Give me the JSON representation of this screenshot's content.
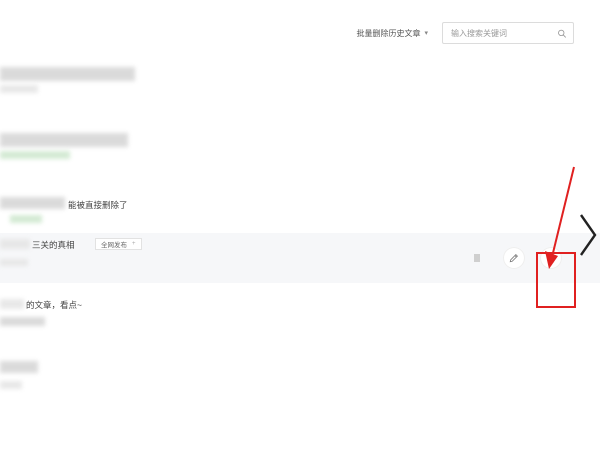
{
  "toolbar": {
    "batch_delete_label": "批量删除历史文章",
    "search_placeholder": "输入搜索关键词"
  },
  "articles": [
    {
      "title": "",
      "meta": ""
    },
    {
      "title": "",
      "meta": ""
    },
    {
      "title": "能被直接删除了",
      "meta": ""
    },
    {
      "title": "三关的真相",
      "tag_label": "全网发布",
      "meta": ""
    },
    {
      "title": "的文章，看点~",
      "meta": ""
    },
    {
      "title": "",
      "meta": ""
    }
  ],
  "colors": {
    "accent_red": "#e02020",
    "row_highlight": "#f6f7f9",
    "border": "#dcdcdc"
  },
  "icons": [
    "search-icon",
    "edit-icon",
    "trash-icon",
    "chevron-right-icon",
    "caret-down-icon"
  ]
}
